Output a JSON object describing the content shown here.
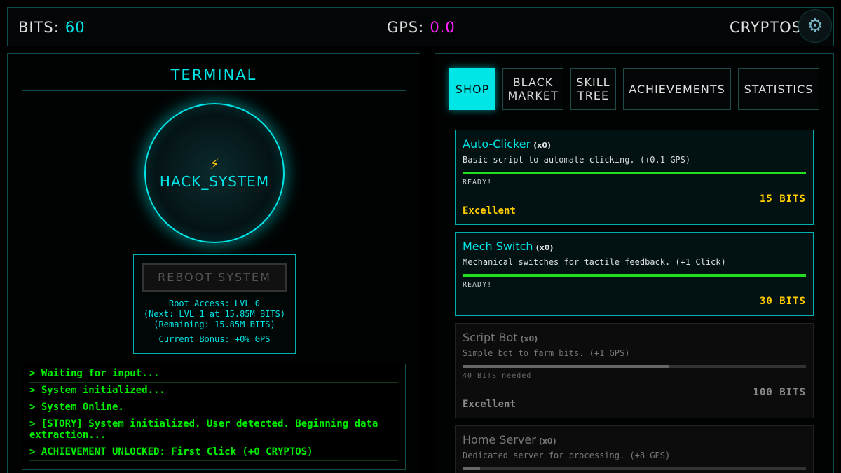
{
  "topbar": {
    "bits_label": "BITS:",
    "bits_value": "60",
    "gps_label": "GPS:",
    "gps_value": "0.0",
    "cryptos_label": "CRYPTOS",
    "settings_icon": "gear-icon"
  },
  "terminal": {
    "title": "TERMINAL",
    "hack_icon": "⚡",
    "hack_label": "HACK_SYSTEM",
    "reboot_label": "REBOOT SYSTEM",
    "root_access": "Root Access: LVL 0",
    "next_level": "(Next: LVL 1 at 15.85M BITS)",
    "remaining": "(Remaining: 15.85M BITS)",
    "current_bonus": "Current Bonus: +0% GPS"
  },
  "log": [
    "> Waiting for input...",
    "> System initialized...",
    "> System Online.",
    "> [STORY] System initialized. User detected. Beginning data extraction...",
    "> ACHIEVEMENT UNLOCKED: First Click (+0 CRYPTOS)"
  ],
  "tabs": [
    {
      "label": "SHOP",
      "active": true
    },
    {
      "label": "BLACK MARKET",
      "active": false
    },
    {
      "label": "SKILL TREE",
      "active": false
    },
    {
      "label": "ACHIEVEMENTS",
      "active": false
    },
    {
      "label": "STATISTICS",
      "active": false
    }
  ],
  "shop": [
    {
      "name": "Auto-Clicker",
      "count": "(x0)",
      "desc": "Basic script to automate clicking. (+0.1 GPS)",
      "progress": 1.0,
      "status": "READY!",
      "price": "15 BITS",
      "rating": "Excellent",
      "locked": false
    },
    {
      "name": "Mech Switch",
      "count": "(x0)",
      "desc": "Mechanical switches for tactile feedback. (+1 Click)",
      "progress": 1.0,
      "status": "READY!",
      "price": "30 BITS",
      "rating": "",
      "locked": false
    },
    {
      "name": "Script Bot",
      "count": "(x0)",
      "desc": "Simple bot to farm bits. (+1 GPS)",
      "progress": 0.6,
      "status": "40 BITS needed",
      "price": "100 BITS",
      "rating": "Excellent",
      "locked": true
    },
    {
      "name": "Home Server",
      "count": "(x0)",
      "desc": "Dedicated server for processing. (+8 GPS)",
      "progress": 0.05,
      "status": "",
      "price": "",
      "rating": "",
      "locked": true
    }
  ],
  "colors": {
    "accent": "#00e5e5",
    "gps": "#ff22ff",
    "log_text": "#00ee00",
    "price": "#ffcc00"
  }
}
